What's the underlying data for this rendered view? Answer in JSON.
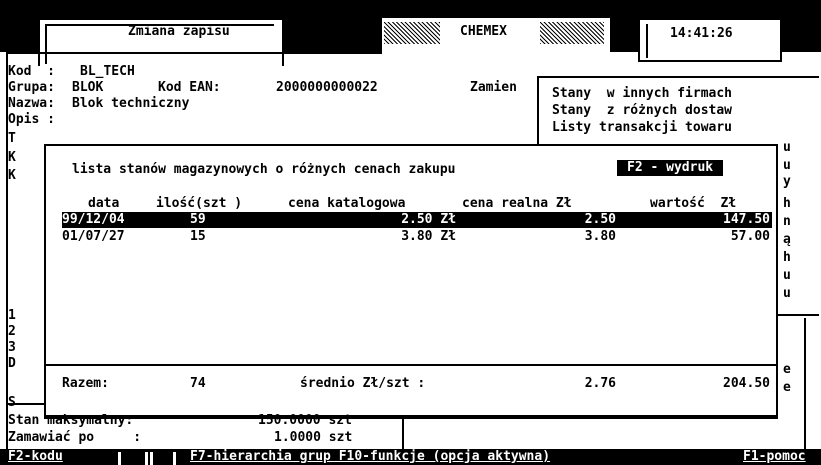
{
  "header": {
    "title": "Zmiana zapisu",
    "company": "CHEMEX",
    "clock": "14:41:26"
  },
  "record": {
    "kod_label": "Kod  :",
    "kod_value": "BL_TECH",
    "grupa_label": "Grupa:",
    "grupa_value": "BLOK",
    "ean_label": "Kod EAN:",
    "ean_value": "2000000000022",
    "zamien": "Zamien",
    "nazwa_label": "Nazwa:",
    "nazwa_value": "Blok techniczny",
    "opis_label": "Opis :"
  },
  "right_menu": {
    "items": [
      "Stany  w innych firmach",
      "Stany  z różnych dostaw",
      "Listy transakcji towaru"
    ]
  },
  "left_stub_letters": [
    "T",
    "K",
    "K",
    "1",
    "2",
    "3",
    "D",
    "S"
  ],
  "right_stub_letters": [
    "u",
    "u",
    "y",
    "h",
    "n",
    "ą",
    "h",
    "u",
    "u",
    "e",
    "e"
  ],
  "dialog": {
    "title": "lista stanów magazynowych o różnych cenach zakupu",
    "print_key": "F2 - wydruk",
    "columns": [
      "data",
      "ilość(szt )",
      "cena katalogowa",
      "cena realna Zł",
      "wartość  Zł"
    ],
    "rows": [
      {
        "data": "99/12/04",
        "ilosc": "59",
        "cena_kat": "2.50 Zł",
        "cena_real": "2.50",
        "wartosc": "147.50",
        "selected": true
      },
      {
        "data": "01/07/27",
        "ilosc": "15",
        "cena_kat": "3.80 Zł",
        "cena_real": "3.80",
        "wartosc": "57.00",
        "selected": false
      }
    ],
    "total_label": "Razem:",
    "total_qty": "74",
    "avg_label": "średnio Zł/szt :",
    "avg_value": "2.76",
    "total_value": "204.50"
  },
  "bottom": {
    "stan_max_label": "Stan maksymalny:",
    "stan_max_value": "150.0000 szt",
    "zamawiac_label": "Zamawiać po     :",
    "zamawiac_value": "1.0000 szt"
  },
  "status_bar": {
    "f2": "F2-kodu",
    "f7": "F7-hierarchia grup F10-funkcje (opcja aktywna)",
    "f1": "F1-pomoc"
  },
  "colors": {
    "foreground": "#000000",
    "background": "#ffffff"
  }
}
